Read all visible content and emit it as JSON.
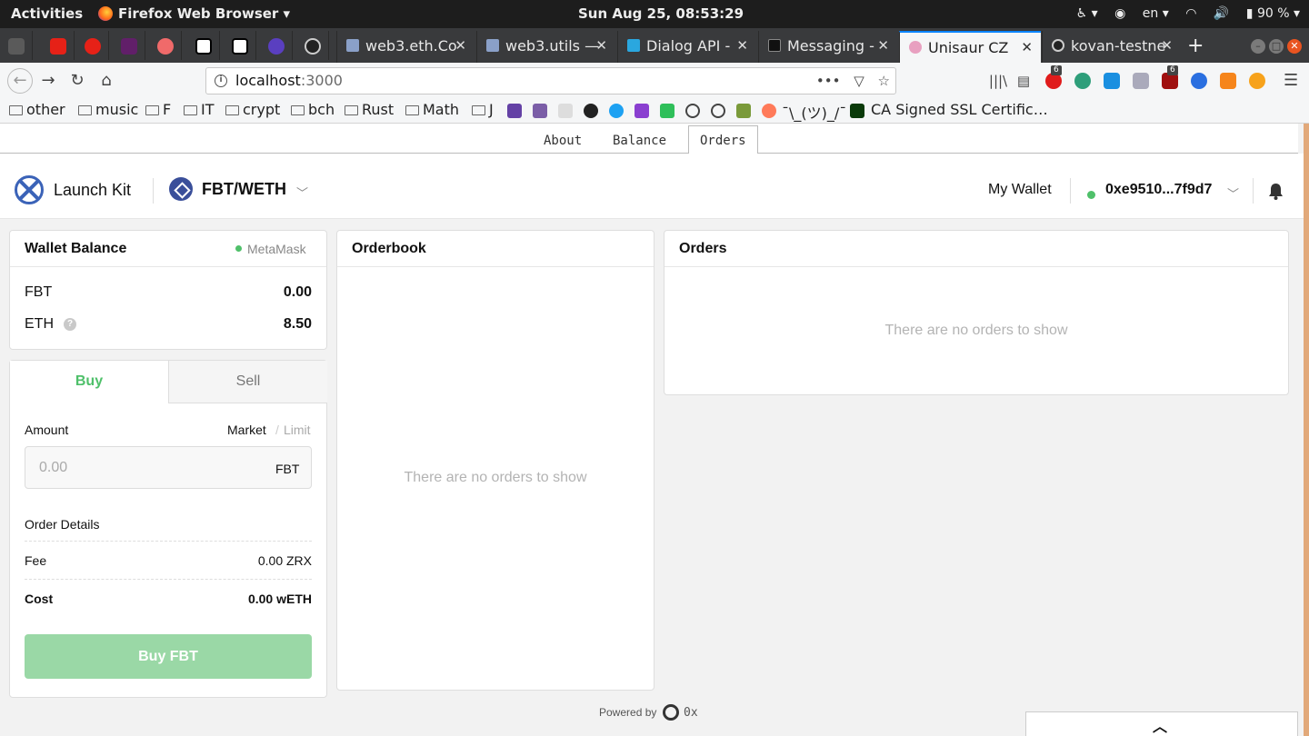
{
  "os": {
    "activities": "Activities",
    "app_name": "Firefox Web Browser",
    "clock": "Sun Aug 25, 08:53:29",
    "language": "en",
    "battery": "90 %"
  },
  "browser": {
    "tabs": [
      {
        "label": "web3.eth.Co"
      },
      {
        "label": "web3.utils —"
      },
      {
        "label": "Dialog API -"
      },
      {
        "label": "Messaging -"
      },
      {
        "label": "Unisaur CZ"
      },
      {
        "label": "kovan-testne"
      }
    ],
    "url_host": "localhost",
    "url_port": ":3000",
    "extension_badges": [
      "6",
      "6"
    ],
    "bookmarks": [
      "other",
      "music",
      "F",
      "IT",
      "crypt",
      "bch",
      "Rust",
      "Math",
      "J"
    ],
    "bookmark_shrug": "¯\\_(ツ)_/¯",
    "bookmark_ssl": "CA Signed SSL Certific…"
  },
  "devtabs": {
    "about": "About",
    "balance": "Balance",
    "orders": "Orders"
  },
  "header": {
    "brand": "Launch Kit",
    "pair": "FBT/WETH",
    "my_wallet": "My Wallet",
    "wallet_address": "0xe9510...7f9d7"
  },
  "wallet_balance": {
    "title": "Wallet Balance",
    "provider": "MetaMask",
    "tokens": [
      {
        "symbol": "FBT",
        "balance": "0.00"
      },
      {
        "symbol": "ETH",
        "balance": "8.50"
      }
    ],
    "help_icon": "?"
  },
  "trade": {
    "tab_buy": "Buy",
    "tab_sell": "Sell",
    "amount_label": "Amount",
    "market": "Market",
    "separator": "/",
    "limit": "Limit",
    "amount_placeholder": "0.00",
    "amount_unit": "FBT",
    "order_details": "Order Details",
    "fee_label": "Fee",
    "fee_value": "0.00 ZRX",
    "cost_label": "Cost",
    "cost_value": "0.00 wETH",
    "submit": "Buy FBT"
  },
  "orderbook": {
    "title": "Orderbook",
    "empty": "There are no orders to show"
  },
  "orders": {
    "title": "Orders",
    "empty": "There are no orders to show"
  },
  "footer": {
    "powered_by": "Powered by",
    "brand": "0x"
  },
  "colors": {
    "accent_green": "#4fc06a",
    "brand_blue": "#3b63b8",
    "firefox_active_tab": "#0a84ff"
  }
}
